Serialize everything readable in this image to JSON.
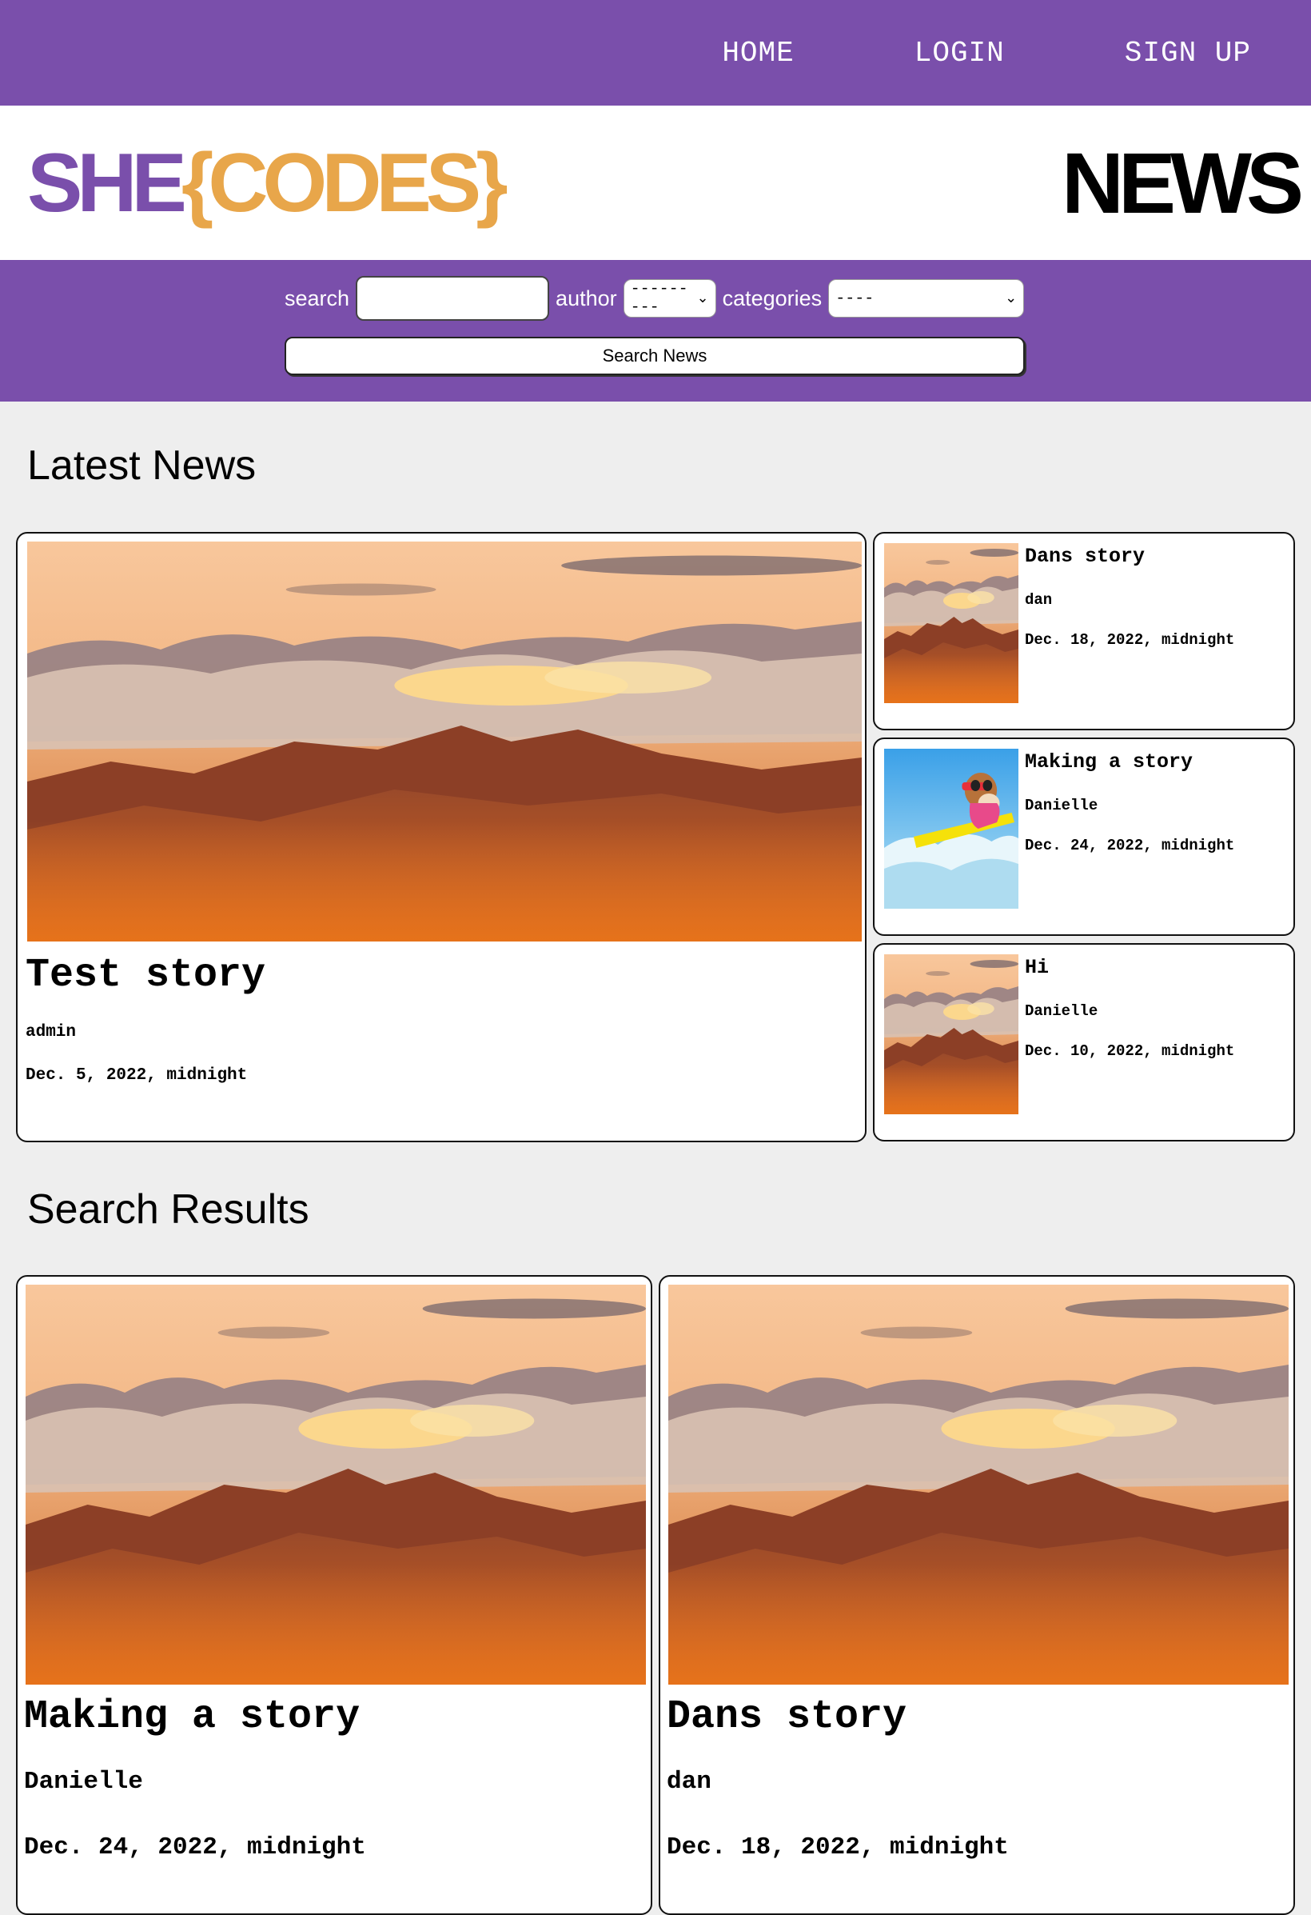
{
  "nav": {
    "items": [
      "HOME",
      "LOGIN",
      "SIGN UP"
    ]
  },
  "brand": {
    "logo_part1": "SHE",
    "logo_part2": "{CODES}",
    "tagline": "NEWS"
  },
  "search": {
    "search_label": "search",
    "search_value": "",
    "author_label": "author",
    "author_selected": "---------",
    "categories_label": "categories",
    "categories_selected": "----",
    "button_label": "Search News"
  },
  "latest": {
    "heading": "Latest News",
    "featured": {
      "title": "Test story",
      "author": "admin",
      "date": "Dec. 5, 2022, midnight"
    },
    "side": [
      {
        "title": "Dans story",
        "author": "dan",
        "date": "Dec. 18, 2022, midnight"
      },
      {
        "title": "Making a story",
        "author": "Danielle",
        "date": "Dec. 24, 2022, midnight"
      },
      {
        "title": "Hi",
        "author": "Danielle",
        "date": "Dec. 10, 2022, midnight"
      }
    ]
  },
  "results": {
    "heading": "Search Results",
    "items": [
      {
        "title": "Making a story",
        "author": "Danielle",
        "date": "Dec. 24, 2022, midnight"
      },
      {
        "title": "Dans story",
        "author": "dan",
        "date": "Dec. 18, 2022, midnight"
      }
    ]
  },
  "colors": {
    "brand_purple": "#7a4fab",
    "brand_orange": "#e8a64a",
    "page_bg": "#eeeeee"
  },
  "icons": {
    "select_arrow": "chevron-down-icon"
  }
}
